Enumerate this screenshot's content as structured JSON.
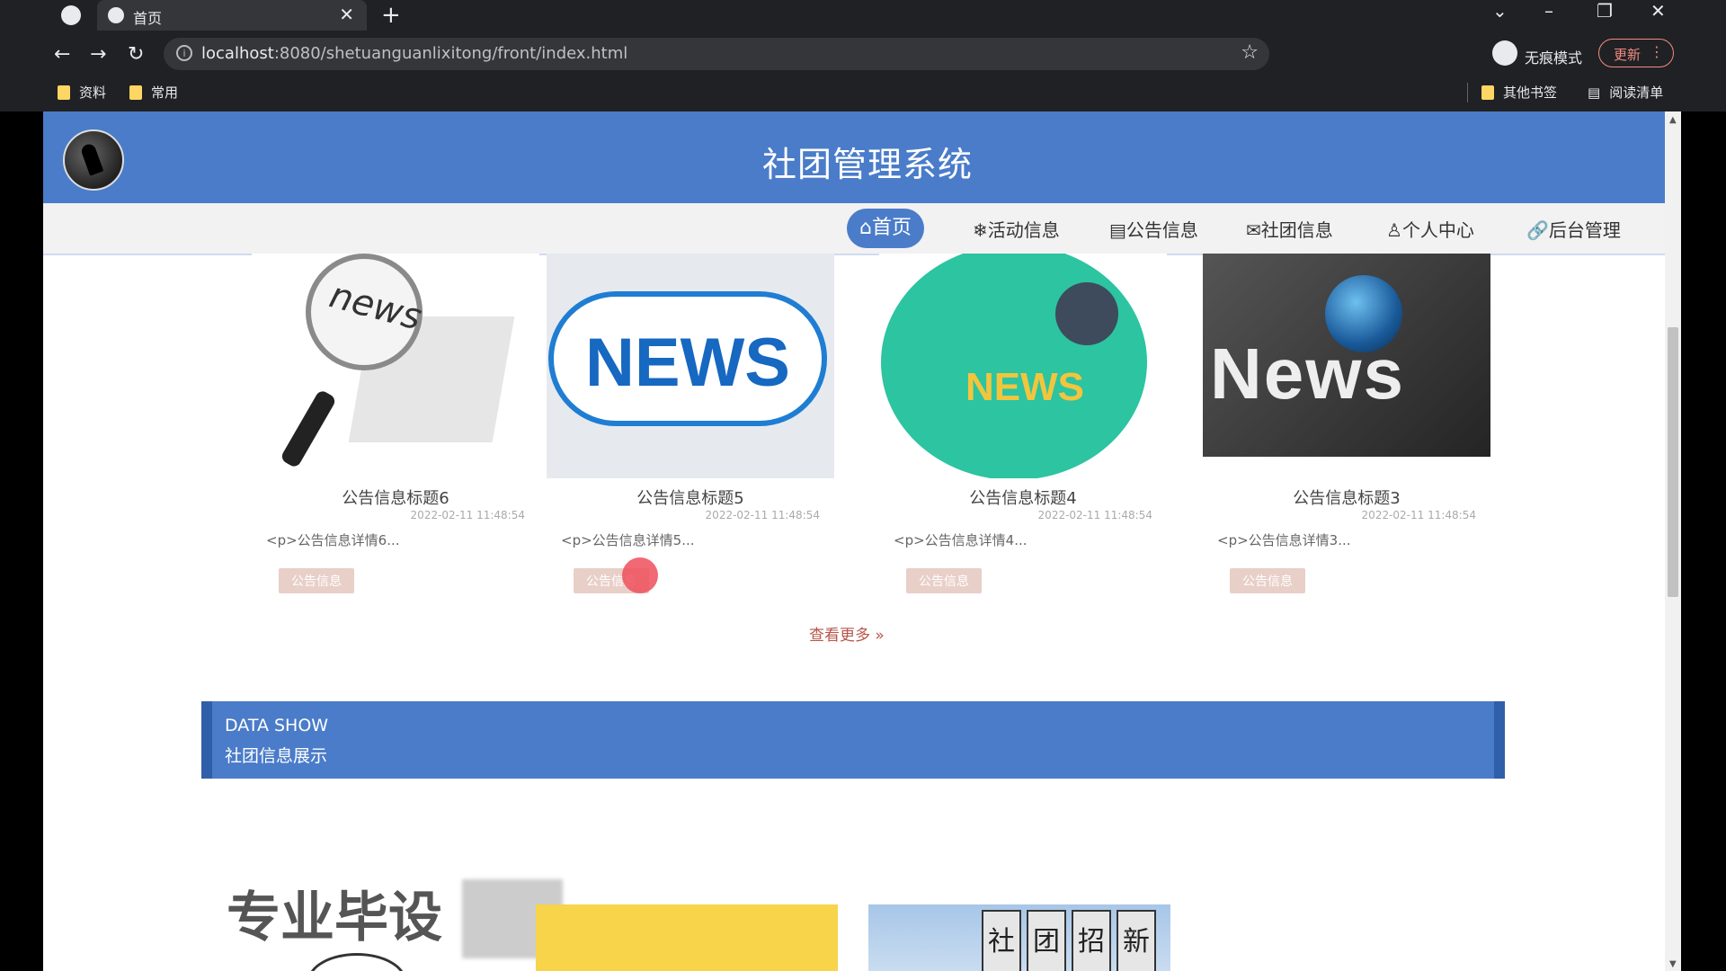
{
  "browser": {
    "tab_title": "首页",
    "url_host": "localhost",
    "url_rest": ":8080/shetuanguanlixitong/front/index.html",
    "incognito_label": "无痕模式",
    "update_label": "更新",
    "bookmarks": [
      "资料",
      "常用"
    ],
    "other_bookmarks": "其他书签",
    "reading_list": "阅读清单"
  },
  "site": {
    "title": "社团管理系统",
    "nav": [
      {
        "icon": "⌂",
        "label": "首页"
      },
      {
        "icon": "❄",
        "label": "活动信息"
      },
      {
        "icon": "▤",
        "label": "公告信息"
      },
      {
        "icon": "✉",
        "label": "社团信息"
      },
      {
        "icon": "♙",
        "label": "个人中心"
      },
      {
        "icon": "🔗",
        "label": "后台管理"
      }
    ]
  },
  "notices": [
    {
      "title": "公告信息标题6",
      "date": "2022-02-11 11:48:54",
      "desc": "<p>公告信息详情6...",
      "button": "公告信息"
    },
    {
      "title": "公告信息标题5",
      "date": "2022-02-11 11:48:54",
      "desc": "<p>公告信息详情5...",
      "button": "公告信息"
    },
    {
      "title": "公告信息标题4",
      "date": "2022-02-11 11:48:54",
      "desc": "<p>公告信息详情4...",
      "button": "公告信息"
    },
    {
      "title": "公告信息标题3",
      "date": "2022-02-11 11:48:54",
      "desc": "<p>公告信息详情3...",
      "button": "公告信息"
    }
  ],
  "images": {
    "card1": "news",
    "card2": "NEWS",
    "card3": "NEWS",
    "card4": "News"
  },
  "more": "查看更多 »",
  "data_section": {
    "en": "DATA SHOW",
    "cn": "社团信息展示"
  },
  "bottom": {
    "banner_text": "专业毕设",
    "chars": [
      "社",
      "团",
      "招",
      "新"
    ]
  }
}
